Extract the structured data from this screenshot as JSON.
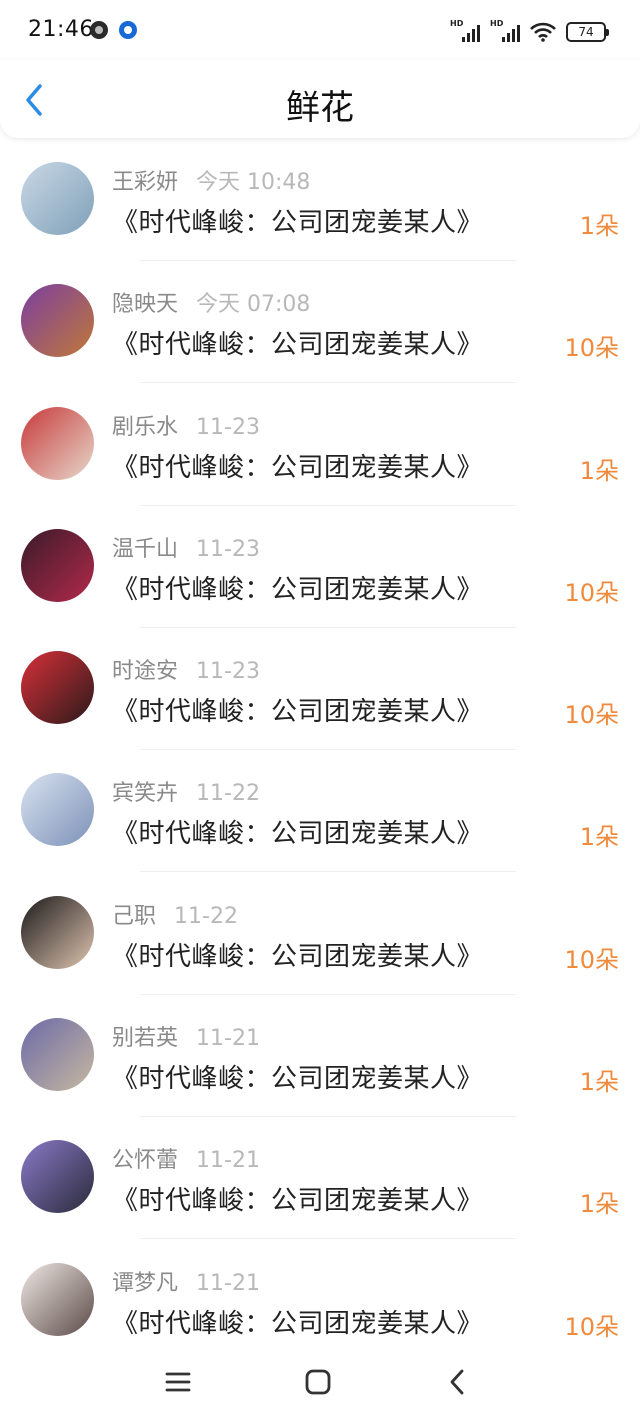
{
  "status_bar": {
    "time": "21:46",
    "signal_1_label": "HD",
    "signal_2_label": "HD",
    "battery": "74",
    "icons": [
      "notification-dot-icon",
      "app-notification-icon",
      "signal-icon",
      "wifi-icon",
      "battery-icon"
    ]
  },
  "header": {
    "title": "鲜花",
    "back_icon": "chevron-left-icon",
    "accent": "#2b8be6"
  },
  "list": {
    "count_color": "#f08a3c",
    "items": [
      {
        "name": "王彩妍",
        "time": "今天 10:48",
        "book": "《时代峰峻：公司团宠姜某人》",
        "count": "1朵",
        "avatar_colors": [
          "#c9d8e6",
          "#7fa0b8"
        ]
      },
      {
        "name": "隐映天",
        "time": "今天 07:08",
        "book": "《时代峰峻：公司团宠姜某人》",
        "count": "10朵",
        "avatar_colors": [
          "#7b3fa0",
          "#c07838"
        ]
      },
      {
        "name": "剧乐水",
        "time": "11-23",
        "book": "《时代峰峻：公司团宠姜某人》",
        "count": "1朵",
        "avatar_colors": [
          "#c83a3a",
          "#e6d8cc"
        ]
      },
      {
        "name": "温千山",
        "time": "11-23",
        "book": "《时代峰峻：公司团宠姜某人》",
        "count": "10朵",
        "avatar_colors": [
          "#3a1a2a",
          "#b22a4a"
        ]
      },
      {
        "name": "时途安",
        "time": "11-23",
        "book": "《时代峰峻：公司团宠姜某人》",
        "count": "10朵",
        "avatar_colors": [
          "#d8303a",
          "#2a1a1a"
        ]
      },
      {
        "name": "宾笑卉",
        "time": "11-22",
        "book": "《时代峰峻：公司团宠姜某人》",
        "count": "1朵",
        "avatar_colors": [
          "#d8e2f0",
          "#7d92b8"
        ]
      },
      {
        "name": "己职",
        "time": "11-22",
        "book": "《时代峰峻：公司团宠姜某人》",
        "count": "10朵",
        "avatar_colors": [
          "#1a1a1a",
          "#e0c4b0"
        ]
      },
      {
        "name": "别若英",
        "time": "11-21",
        "book": "《时代峰峻：公司团宠姜某人》",
        "count": "1朵",
        "avatar_colors": [
          "#6a6aa8",
          "#c8b8a0"
        ]
      },
      {
        "name": "公怀蕾",
        "time": "11-21",
        "book": "《时代峰峻：公司团宠姜某人》",
        "count": "1朵",
        "avatar_colors": [
          "#8a7ac8",
          "#2a2a3a"
        ]
      },
      {
        "name": "谭梦凡",
        "time": "11-21",
        "book": "《时代峰峻：公司团宠姜某人》",
        "count": "10朵",
        "avatar_colors": [
          "#f0e8e4",
          "#5a4a48"
        ]
      }
    ]
  },
  "nav_bar": {
    "icons": [
      "menu-icon",
      "home-icon",
      "back-icon"
    ]
  }
}
